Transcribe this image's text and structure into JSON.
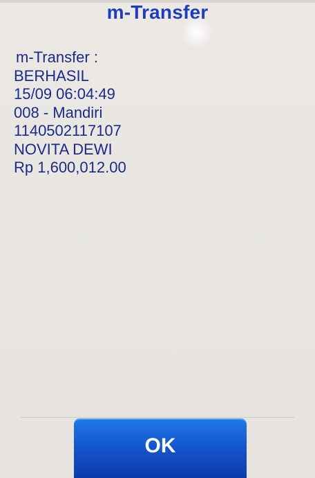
{
  "dialog": {
    "title": "m-Transfer",
    "lines": [
      "m-Transfer :",
      "BERHASIL",
      "15/09 06:04:49",
      "008 - Mandiri",
      "1140502117107",
      "NOVITA DEWI",
      "Rp 1,600,012.00"
    ]
  },
  "buttons": {
    "ok_label": "OK"
  },
  "colors": {
    "title": "#1f3db8",
    "text": "#1b2a86",
    "button": "#1557cf",
    "background": "#e9e6e2"
  }
}
